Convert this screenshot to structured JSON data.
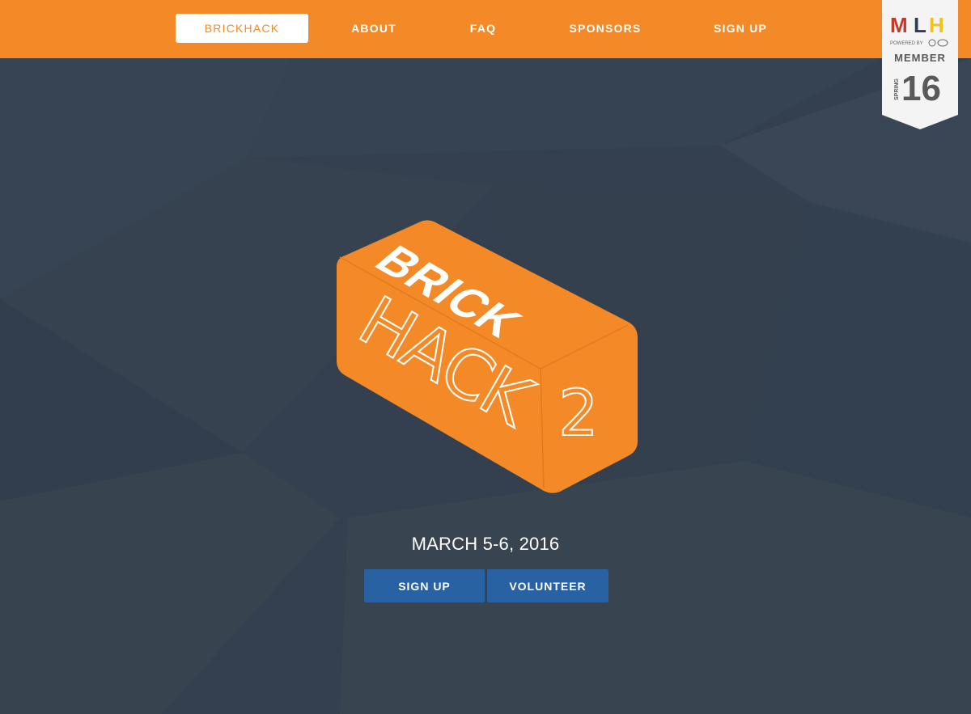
{
  "nav": {
    "brand_label": "BRICKHACK",
    "items": [
      {
        "label": "ABOUT"
      },
      {
        "label": "FAQ"
      },
      {
        "label": "SPONSORS"
      },
      {
        "label": "SIGN UP"
      }
    ]
  },
  "mlh_badge": {
    "logo_letters": [
      "M",
      "L",
      "H"
    ],
    "powered_by": "POWERED BY",
    "member": "MEMBER",
    "season": "SPRING",
    "year": "16"
  },
  "hero": {
    "logo_line1": "BRICK",
    "logo_line2": "HACK",
    "logo_number": "2",
    "date": "MARCH 5-6, 2016"
  },
  "cta": {
    "signup_label": "SIGN UP",
    "volunteer_label": "VOLUNTEER"
  },
  "colors": {
    "background": "#34404f",
    "orange": "#f48a27",
    "button_blue": "#2862a2",
    "white": "#ffffff"
  }
}
